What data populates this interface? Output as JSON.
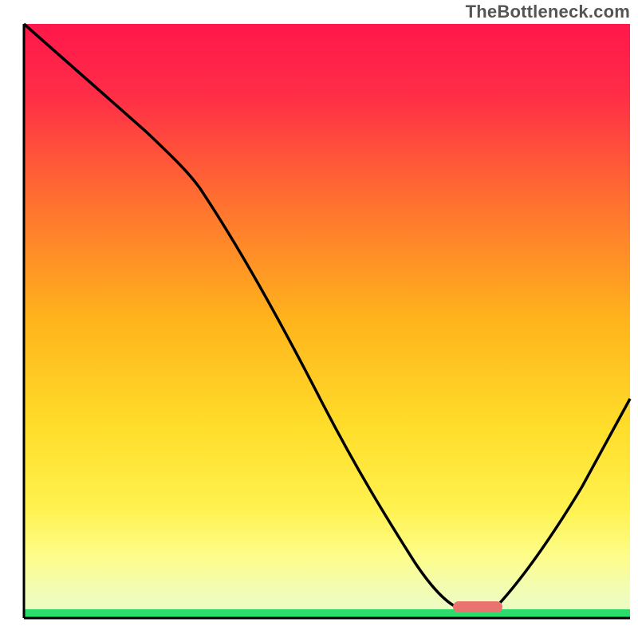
{
  "watermark": "TheBottleneck.com",
  "chart_data": {
    "type": "line",
    "title": "",
    "xlabel": "",
    "ylabel": "",
    "xlim": [
      0,
      100
    ],
    "ylim": [
      0,
      100
    ],
    "gradient_colors": {
      "top": "#ff1a4a",
      "upper_mid": "#ffb400",
      "lower_mid": "#ffe850",
      "bottom_strip": "#f8fca8",
      "ground": "#2cdc6a"
    },
    "curve_note": "Black curve descends from top-left, inflects, reaches a flat minimum near x≈70–78 at y≈2, then rises toward the right edge.",
    "series": [
      {
        "name": "bottleneck-curve",
        "x": [
          0,
          10,
          20,
          27,
          35,
          45,
          55,
          62,
          68,
          72,
          78,
          85,
          92,
          100
        ],
        "y": [
          100,
          91,
          82,
          75,
          62,
          46,
          31,
          20,
          9,
          3,
          3,
          12,
          23,
          37
        ]
      }
    ],
    "marker": {
      "name": "optimal-range-pill",
      "x_center": 74,
      "y_center": 2.5,
      "width_pct": 8,
      "color": "#e9746f"
    }
  }
}
